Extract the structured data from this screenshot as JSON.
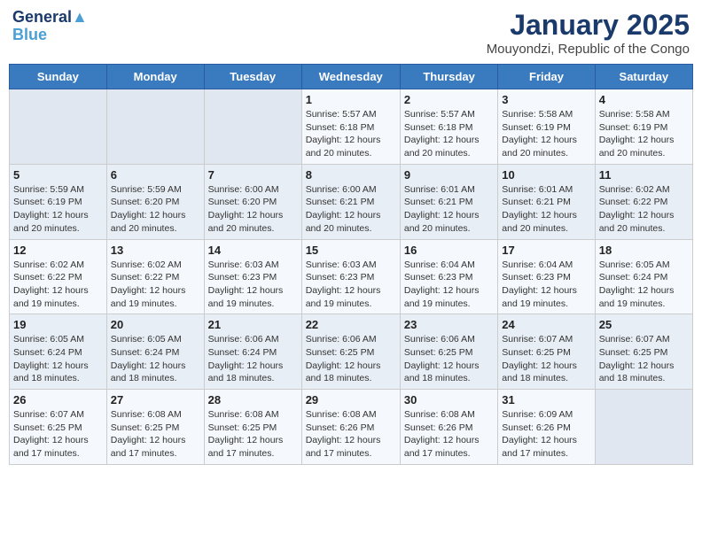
{
  "logo": {
    "line1": "General",
    "line2": "Blue"
  },
  "title": "January 2025",
  "subtitle": "Mouyondzi, Republic of the Congo",
  "days_of_week": [
    "Sunday",
    "Monday",
    "Tuesday",
    "Wednesday",
    "Thursday",
    "Friday",
    "Saturday"
  ],
  "weeks": [
    [
      {
        "day": "",
        "info": ""
      },
      {
        "day": "",
        "info": ""
      },
      {
        "day": "",
        "info": ""
      },
      {
        "day": "1",
        "info": "Sunrise: 5:57 AM\nSunset: 6:18 PM\nDaylight: 12 hours and 20 minutes."
      },
      {
        "day": "2",
        "info": "Sunrise: 5:57 AM\nSunset: 6:18 PM\nDaylight: 12 hours and 20 minutes."
      },
      {
        "day": "3",
        "info": "Sunrise: 5:58 AM\nSunset: 6:19 PM\nDaylight: 12 hours and 20 minutes."
      },
      {
        "day": "4",
        "info": "Sunrise: 5:58 AM\nSunset: 6:19 PM\nDaylight: 12 hours and 20 minutes."
      }
    ],
    [
      {
        "day": "5",
        "info": "Sunrise: 5:59 AM\nSunset: 6:19 PM\nDaylight: 12 hours and 20 minutes."
      },
      {
        "day": "6",
        "info": "Sunrise: 5:59 AM\nSunset: 6:20 PM\nDaylight: 12 hours and 20 minutes."
      },
      {
        "day": "7",
        "info": "Sunrise: 6:00 AM\nSunset: 6:20 PM\nDaylight: 12 hours and 20 minutes."
      },
      {
        "day": "8",
        "info": "Sunrise: 6:00 AM\nSunset: 6:21 PM\nDaylight: 12 hours and 20 minutes."
      },
      {
        "day": "9",
        "info": "Sunrise: 6:01 AM\nSunset: 6:21 PM\nDaylight: 12 hours and 20 minutes."
      },
      {
        "day": "10",
        "info": "Sunrise: 6:01 AM\nSunset: 6:21 PM\nDaylight: 12 hours and 20 minutes."
      },
      {
        "day": "11",
        "info": "Sunrise: 6:02 AM\nSunset: 6:22 PM\nDaylight: 12 hours and 20 minutes."
      }
    ],
    [
      {
        "day": "12",
        "info": "Sunrise: 6:02 AM\nSunset: 6:22 PM\nDaylight: 12 hours and 19 minutes."
      },
      {
        "day": "13",
        "info": "Sunrise: 6:02 AM\nSunset: 6:22 PM\nDaylight: 12 hours and 19 minutes."
      },
      {
        "day": "14",
        "info": "Sunrise: 6:03 AM\nSunset: 6:23 PM\nDaylight: 12 hours and 19 minutes."
      },
      {
        "day": "15",
        "info": "Sunrise: 6:03 AM\nSunset: 6:23 PM\nDaylight: 12 hours and 19 minutes."
      },
      {
        "day": "16",
        "info": "Sunrise: 6:04 AM\nSunset: 6:23 PM\nDaylight: 12 hours and 19 minutes."
      },
      {
        "day": "17",
        "info": "Sunrise: 6:04 AM\nSunset: 6:23 PM\nDaylight: 12 hours and 19 minutes."
      },
      {
        "day": "18",
        "info": "Sunrise: 6:05 AM\nSunset: 6:24 PM\nDaylight: 12 hours and 19 minutes."
      }
    ],
    [
      {
        "day": "19",
        "info": "Sunrise: 6:05 AM\nSunset: 6:24 PM\nDaylight: 12 hours and 18 minutes."
      },
      {
        "day": "20",
        "info": "Sunrise: 6:05 AM\nSunset: 6:24 PM\nDaylight: 12 hours and 18 minutes."
      },
      {
        "day": "21",
        "info": "Sunrise: 6:06 AM\nSunset: 6:24 PM\nDaylight: 12 hours and 18 minutes."
      },
      {
        "day": "22",
        "info": "Sunrise: 6:06 AM\nSunset: 6:25 PM\nDaylight: 12 hours and 18 minutes."
      },
      {
        "day": "23",
        "info": "Sunrise: 6:06 AM\nSunset: 6:25 PM\nDaylight: 12 hours and 18 minutes."
      },
      {
        "day": "24",
        "info": "Sunrise: 6:07 AM\nSunset: 6:25 PM\nDaylight: 12 hours and 18 minutes."
      },
      {
        "day": "25",
        "info": "Sunrise: 6:07 AM\nSunset: 6:25 PM\nDaylight: 12 hours and 18 minutes."
      }
    ],
    [
      {
        "day": "26",
        "info": "Sunrise: 6:07 AM\nSunset: 6:25 PM\nDaylight: 12 hours and 17 minutes."
      },
      {
        "day": "27",
        "info": "Sunrise: 6:08 AM\nSunset: 6:25 PM\nDaylight: 12 hours and 17 minutes."
      },
      {
        "day": "28",
        "info": "Sunrise: 6:08 AM\nSunset: 6:25 PM\nDaylight: 12 hours and 17 minutes."
      },
      {
        "day": "29",
        "info": "Sunrise: 6:08 AM\nSunset: 6:26 PM\nDaylight: 12 hours and 17 minutes."
      },
      {
        "day": "30",
        "info": "Sunrise: 6:08 AM\nSunset: 6:26 PM\nDaylight: 12 hours and 17 minutes."
      },
      {
        "day": "31",
        "info": "Sunrise: 6:09 AM\nSunset: 6:26 PM\nDaylight: 12 hours and 17 minutes."
      },
      {
        "day": "",
        "info": ""
      }
    ]
  ]
}
